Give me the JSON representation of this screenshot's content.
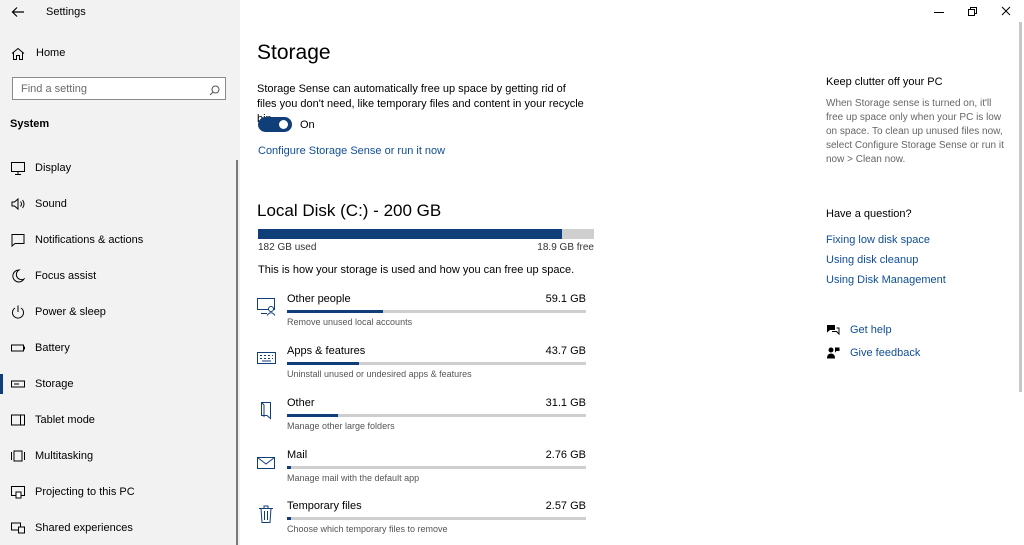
{
  "window": {
    "title": "Settings",
    "controls": [
      "minimize-icon",
      "restore-icon",
      "close-icon"
    ]
  },
  "sidebar": {
    "home_label": "Home",
    "search_placeholder": "Find a setting",
    "section": "System",
    "items": [
      {
        "label": "Display",
        "icon": "display-icon"
      },
      {
        "label": "Sound",
        "icon": "sound-icon"
      },
      {
        "label": "Notifications & actions",
        "icon": "notifications-icon"
      },
      {
        "label": "Focus assist",
        "icon": "moon-icon"
      },
      {
        "label": "Power & sleep",
        "icon": "power-icon"
      },
      {
        "label": "Battery",
        "icon": "battery-icon"
      },
      {
        "label": "Storage",
        "icon": "storage-icon",
        "active": true
      },
      {
        "label": "Tablet mode",
        "icon": "tablet-icon"
      },
      {
        "label": "Multitasking",
        "icon": "multitasking-icon"
      },
      {
        "label": "Projecting to this PC",
        "icon": "projecting-icon"
      },
      {
        "label": "Shared experiences",
        "icon": "shared-icon"
      }
    ]
  },
  "main": {
    "title": "Storage",
    "description": "Storage Sense can automatically free up space by getting rid of files you don't need, like temporary files and content in your recycle bin.",
    "toggle": {
      "state": "On",
      "on": true
    },
    "configure_link": "Configure Storage Sense or run it now",
    "disk": {
      "title": "Local Disk (C:) - 200 GB",
      "used": "182 GB used",
      "free": "18.9 GB free",
      "used_fraction": 0.905
    },
    "usage_description": "This is how your storage is used and how you can free up space.",
    "categories": [
      {
        "name": "Other people",
        "size": "59.1 GB",
        "sub": "Remove unused local accounts",
        "icon": "user-icon",
        "fraction": 0.32
      },
      {
        "name": "Apps & features",
        "size": "43.7 GB",
        "sub": "Uninstall unused or undesired apps & features",
        "icon": "keyboard-icon",
        "fraction": 0.24
      },
      {
        "name": "Other",
        "size": "31.1 GB",
        "sub": "Manage other large folders",
        "icon": "document-icon",
        "fraction": 0.17
      },
      {
        "name": "Mail",
        "size": "2.76 GB",
        "sub": "Manage mail with the default app",
        "icon": "mail-icon",
        "fraction": 0.015
      },
      {
        "name": "Temporary files",
        "size": "2.57 GB",
        "sub": "Choose which temporary files to remove",
        "icon": "trash-icon",
        "fraction": 0.014
      }
    ]
  },
  "right": {
    "clutter_title": "Keep clutter off your PC",
    "clutter_text": "When Storage sense is turned on, it'll free up space only when your PC is low on space. To clean up unused files now, select Configure Storage Sense or run it now > Clean now.",
    "question_title": "Have a question?",
    "links": [
      "Fixing low disk space",
      "Using disk cleanup",
      "Using Disk Management"
    ],
    "help_label": "Get help",
    "feedback_label": "Give feedback"
  },
  "colors": {
    "accent": "#0f3e79",
    "link": "#0f4e96",
    "track": "#cfcfcf",
    "sidebar_bg": "#f2f2f2"
  }
}
